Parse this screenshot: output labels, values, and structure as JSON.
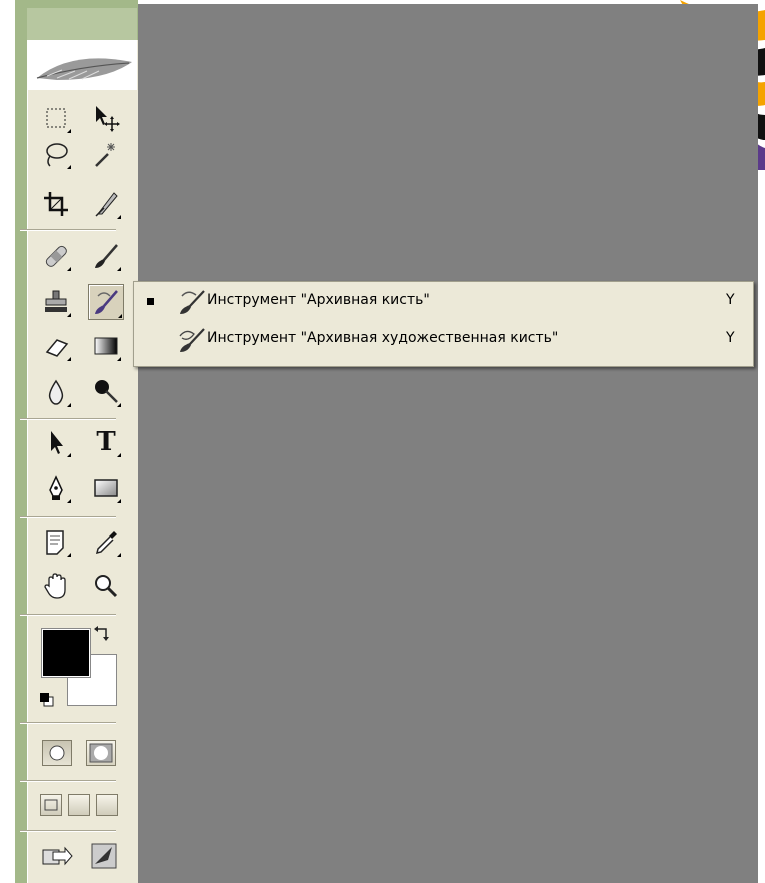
{
  "toolbox": {
    "tools": [
      {
        "name": "rectangular-marquee-tool",
        "icon": "marquee-icon"
      },
      {
        "name": "move-tool",
        "icon": "move-icon"
      },
      {
        "name": "lasso-tool",
        "icon": "lasso-icon"
      },
      {
        "name": "magic-wand-tool",
        "icon": "magic-wand-icon"
      },
      {
        "name": "crop-tool",
        "icon": "crop-icon"
      },
      {
        "name": "slice-tool",
        "icon": "slice-icon"
      },
      {
        "name": "healing-brush-tool",
        "icon": "bandage-icon"
      },
      {
        "name": "brush-tool",
        "icon": "brush-icon"
      },
      {
        "name": "clone-stamp-tool",
        "icon": "stamp-icon"
      },
      {
        "name": "history-brush-tool",
        "icon": "history-brush-icon",
        "active": true
      },
      {
        "name": "eraser-tool",
        "icon": "eraser-icon"
      },
      {
        "name": "gradient-tool",
        "icon": "gradient-icon"
      },
      {
        "name": "blur-tool",
        "icon": "drop-icon"
      },
      {
        "name": "dodge-tool",
        "icon": "dodge-icon"
      },
      {
        "name": "path-selection-tool",
        "icon": "arrow-icon"
      },
      {
        "name": "type-tool",
        "icon": "type-icon"
      },
      {
        "name": "pen-tool",
        "icon": "pen-icon"
      },
      {
        "name": "shape-tool",
        "icon": "rectangle-shape-icon"
      },
      {
        "name": "notes-tool",
        "icon": "notes-icon"
      },
      {
        "name": "eyedropper-tool",
        "icon": "eyedropper-icon"
      },
      {
        "name": "hand-tool",
        "icon": "hand-icon"
      },
      {
        "name": "zoom-tool",
        "icon": "zoom-icon"
      }
    ],
    "type_tool_glyph": "T",
    "foreground_color": "#000000",
    "background_color": "#ffffff"
  },
  "flyout": {
    "items": [
      {
        "label": "Инструмент \"Архивная кисть\"",
        "shortcut": "Y",
        "selected": true
      },
      {
        "label": "Инструмент \"Архивная художественная кисть\"",
        "shortcut": "Y",
        "selected": false
      }
    ]
  },
  "colors": {
    "canvas": "#808080",
    "toolbox_frame": "#a3b889",
    "panel": "#ece9d8"
  }
}
